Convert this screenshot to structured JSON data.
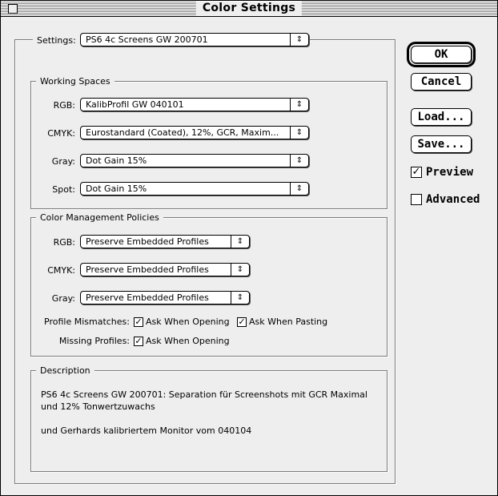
{
  "window": {
    "title": "Color Settings"
  },
  "settings": {
    "label": "Settings:",
    "value": "PS6 4c Screens GW 200701"
  },
  "working_spaces": {
    "title": "Working Spaces",
    "rows": [
      {
        "label": "RGB:",
        "value": "KalibProfil GW 040101"
      },
      {
        "label": "CMYK:",
        "value": "Eurostandard (Coated), 12%, GCR, Maxim..."
      },
      {
        "label": "Gray:",
        "value": "Dot Gain 15%"
      },
      {
        "label": "Spot:",
        "value": "Dot Gain 15%"
      }
    ]
  },
  "policies": {
    "title": "Color Management Policies",
    "rows": [
      {
        "label": "RGB:",
        "value": "Preserve Embedded Profiles"
      },
      {
        "label": "CMYK:",
        "value": "Preserve Embedded Profiles"
      },
      {
        "label": "Gray:",
        "value": "Preserve Embedded Profiles"
      }
    ],
    "profile_mismatches": {
      "label": "Profile Mismatches:",
      "ask_opening": {
        "label": "Ask When Opening",
        "checked": true
      },
      "ask_pasting": {
        "label": "Ask When Pasting",
        "checked": true
      }
    },
    "missing_profiles": {
      "label": "Missing Profiles:",
      "ask_opening": {
        "label": "Ask When Opening",
        "checked": true
      }
    }
  },
  "description": {
    "title": "Description",
    "line1": "PS6 4c Screens GW 200701:  Separation für Screenshots mit GCR Maximal",
    "line2": "und 12% Tonwertzuwachs",
    "line3": "und Gerhards kalibriertem Monitor vom 040104"
  },
  "buttons": {
    "ok": "OK",
    "cancel": "Cancel",
    "load": "Load...",
    "save": "Save..."
  },
  "options": {
    "preview": {
      "label": "Preview",
      "checked": true
    },
    "advanced": {
      "label": "Advanced",
      "checked": false
    }
  },
  "icons": {
    "popup_arrow": "updown-arrows-icon",
    "check": "checkmark-icon"
  }
}
